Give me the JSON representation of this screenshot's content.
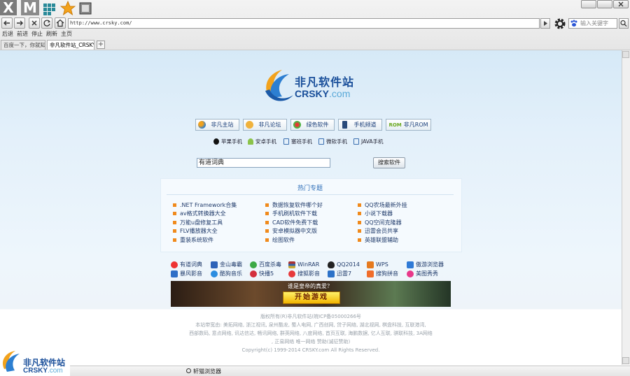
{
  "browser": {
    "logo_letters": [
      "X",
      "M"
    ],
    "nav_labels": [
      "后退",
      "前进",
      "停止",
      "刷新",
      "主页"
    ],
    "address": "http://www.crsky.com/",
    "search_placeholder": "输入关键字",
    "tabs": [
      {
        "label": "百度一下，你就知",
        "active": false
      },
      {
        "label": "非凡软件站_CRSKY",
        "active": true
      }
    ],
    "new_tab": "+"
  },
  "site": {
    "logo_cn": "非凡软件站",
    "logo_en_main": "CRSKY",
    "logo_en_dot": ".com",
    "nav_buttons": [
      "非凡主站",
      "非凡论坛",
      "绿色软件",
      "手机频道",
      "非凡ROM"
    ],
    "nav_rom_badge": "ROM",
    "platform_links": [
      "苹果手机",
      "安卓手机",
      "塞班手机",
      "微软手机",
      "JAVA手机"
    ],
    "search_value": "有道词典",
    "search_button": "搜索软件",
    "topics_title": "热门专题",
    "topics": [
      [
        ".NET Framework合集",
        "av格式转换器大全",
        "万能u盘修复工具",
        "FLV播放器大全",
        "重装系统软件"
      ],
      [
        "数据恢复软件哪个好",
        "手机刷机软件下载",
        "CAD软件免费下载",
        "安卓模拟器中文版",
        "绘图软件"
      ],
      [
        "QQ农场最新外挂",
        "小说下载器",
        "QQ空间克隆器",
        "迅雷会员共享",
        "英雄联盟辅助"
      ]
    ],
    "apps_row1": [
      "有道词典",
      "金山毒霸",
      "百度杀毒",
      "WinRAR",
      "QQ2014",
      "WPS",
      "傲游浏览器"
    ],
    "apps_row2": [
      "暴风影音",
      "酷狗音乐",
      "快播5",
      "搜狐影音",
      "迅雷7",
      "搜狗拼音",
      "美图秀秀"
    ],
    "banner_question": "谁是皇帝的真爱？",
    "banner_button": "开始游戏",
    "footer": [
      "版权所有(R)非凡软件站(皖ICP备05000266号",
      "本站带宽由: 美拓网络, 浙江视讯, 泉州酷龙, 蜀人电网, 广西创网, 贷子网络, 湖北视网, 棋盘科技, 互联港湾,",
      "西部数码, 意点网络, 讯达信达, 畅讯网络, 群英网络, 八度网络, 首页互联, 海鹏数据, 亿人互联, 骐联科技, 3A网络",
      ", 正易网络 唯一网络 赞助(诚征赞助)",
      "Copyright(c) 1999-2014 CRSKY.com All Rights Reserved."
    ],
    "status_text": "轩猫浏览器"
  },
  "colors": {
    "accent": "#1a4f9a",
    "topic_title": "#2f6fb9",
    "bullet": "#f08a1c"
  }
}
